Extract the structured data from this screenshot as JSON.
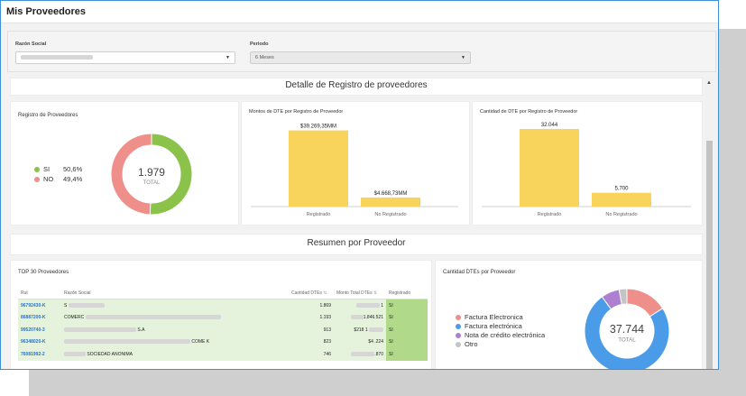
{
  "page_title": "Mis Proveedores",
  "filters": {
    "razon_social_label": "Razón Social",
    "periodo_label": "Periodo",
    "periodo_value": "6 Meses"
  },
  "section1_title": "Detalle de Registro de proveedores",
  "section2_title": "Resumen por Proveedor",
  "registro": {
    "title": "Registro de Proveedores",
    "total_value": "1.979",
    "total_label": "TOTAL",
    "legend": [
      {
        "label": "SI",
        "pct": "50,6%",
        "color": "#8bc34a"
      },
      {
        "label": "NO",
        "pct": "49,4%",
        "color": "#ef8f8a"
      }
    ]
  },
  "chart_data": [
    {
      "type": "pie",
      "title": "Registro de Proveedores",
      "center_value": "1.979",
      "center_label": "TOTAL",
      "slices": [
        {
          "label": "SI",
          "value": 50.6,
          "color": "#8bc34a"
        },
        {
          "label": "NO",
          "value": 49.4,
          "color": "#ef8f8a"
        }
      ]
    },
    {
      "type": "bar",
      "title": "Montos de DTE por Registro de Proveedor",
      "categories": [
        "Registrado",
        "No Registrado"
      ],
      "values": [
        39269.35,
        4668.73
      ],
      "labels": [
        "$39.269,35MM",
        "$4.668,73MM"
      ],
      "color": "#f8d45c",
      "ylim": [
        0,
        40000
      ]
    },
    {
      "type": "bar",
      "title": "Cantidad de DTE por Registro de Proveedor",
      "categories": [
        "Registrado",
        "No Registrado"
      ],
      "values": [
        32044,
        5700
      ],
      "labels": [
        "32.044",
        "5.700"
      ],
      "color": "#f8d45c",
      "ylim": [
        0,
        32044
      ]
    },
    {
      "type": "pie",
      "title": "Cantidad DTEs por Proveedor",
      "center_value": "37.744",
      "center_label": "TOTAL",
      "slices": [
        {
          "label": "Factura Electronica",
          "value": 16,
          "color": "#ef8f8a"
        },
        {
          "label": "Factura electrónica",
          "value": 74,
          "color": "#4a9be8"
        },
        {
          "label": "Nota de crédito electrónica",
          "value": 7,
          "color": "#ae7fd0"
        },
        {
          "label": "Otro",
          "value": 3,
          "color": "#c4c4c4"
        }
      ]
    }
  ],
  "top30": {
    "title": "TOP 30 Proveedores",
    "columns": [
      "Rut",
      "Razón Social",
      "Cantidad DTEs",
      "Monto Total DTEs",
      "Registrado"
    ],
    "rows": [
      {
        "rut": "96792430-K",
        "razon": "S",
        "cantidad": "1.869",
        "monto": "1",
        "reg": "SI"
      },
      {
        "rut": "86887200-K",
        "razon": "COMERC",
        "cantidad": "1.193",
        "monto": "1.846.521",
        "reg": "SI"
      },
      {
        "rut": "99520740-3",
        "razon": "S.A",
        "cantidad": "913",
        "monto": "$218 1",
        "reg": "SI"
      },
      {
        "rut": "96348020-K",
        "razon": "COME K",
        "cantidad": "823",
        "monto": "$4 .224",
        "reg": "SI"
      },
      {
        "rut": "76081992-2",
        "razon": "SOCIEDAD ANONIMA",
        "cantidad": "746",
        "monto": ".870",
        "reg": "SI"
      }
    ]
  },
  "dtes": {
    "title": "Cantidad DTEs por Proveedor",
    "total_value": "37.744",
    "total_label": "TOTAL"
  }
}
